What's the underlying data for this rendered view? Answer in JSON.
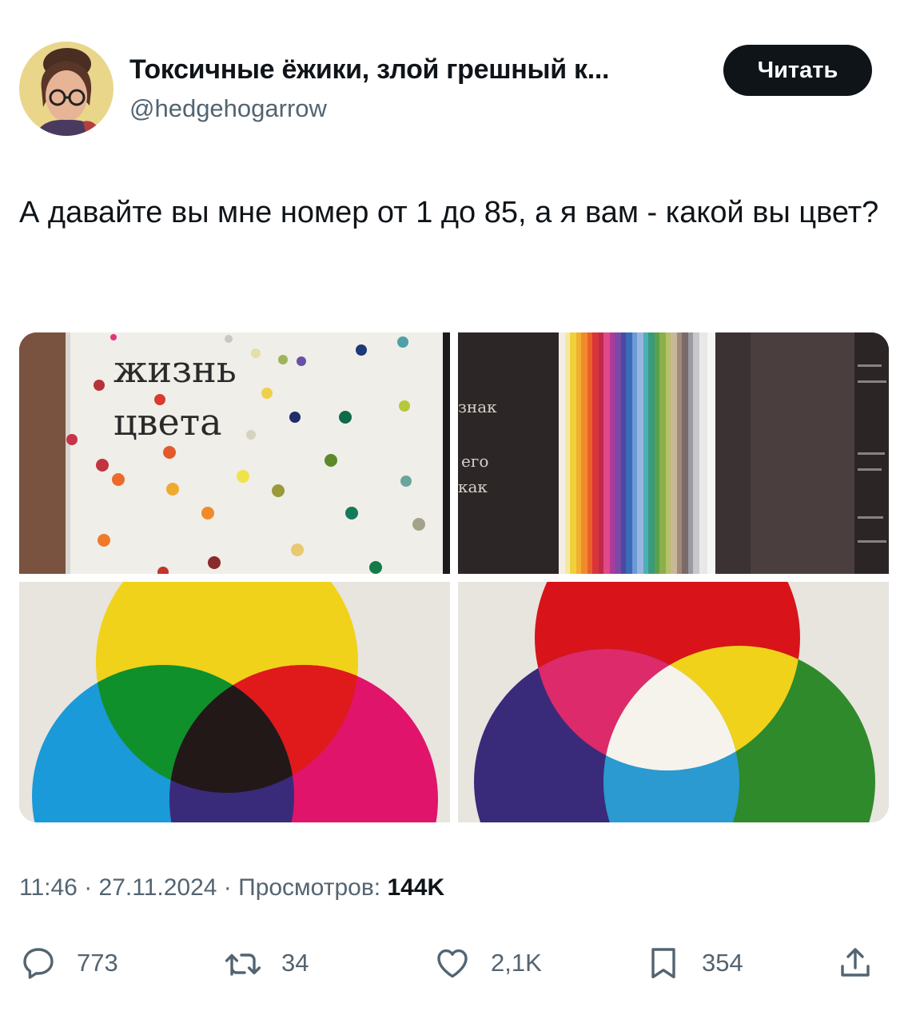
{
  "author": {
    "name": "Токсичные ёжики, злой грешный к...",
    "handle": "@hedgehogarrow"
  },
  "read_button": {
    "label": "Читать"
  },
  "tweet": {
    "text": "А давайте вы мне номер от 1 до 85, а я вам - какой вы цвет?"
  },
  "media": {
    "photo1": {
      "title_line1": "жизнь",
      "title_line2": "цвета"
    },
    "photo2": {
      "page_text": [
        "знак",
        "его",
        "как"
      ]
    }
  },
  "meta": {
    "time": "11:46",
    "date": "27.11.2024",
    "views_label": "Просмотров:",
    "views_count": "144K"
  },
  "actions": {
    "replies": "773",
    "retweets": "34",
    "likes": "2,1K",
    "bookmarks": "354"
  },
  "colors": {
    "text_primary": "#0f1419",
    "text_secondary": "#536471",
    "button_bg": "#0f1419"
  }
}
